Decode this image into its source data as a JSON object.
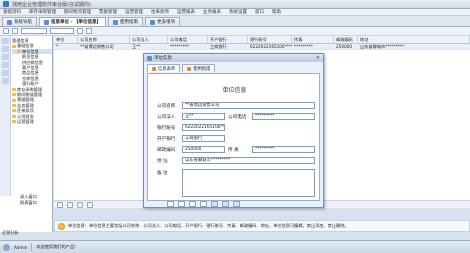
{
  "window": {
    "title": "测用企业管理软件审合版(在试期内)"
  },
  "menu": [
    "基础资料",
    "库存采购管理",
    "期间物流管理",
    "票据管理",
    "运营管理",
    "往来款项",
    "运营报表",
    "业务报表",
    "系统设置",
    "窗口",
    "帮助"
  ],
  "tabs": [
    {
      "label": "系统导航"
    },
    {
      "label": "信息单位 - 【单位信息】"
    },
    {
      "label": "使用指南"
    },
    {
      "label": "更多增项"
    }
  ],
  "toolbar": {
    "select_placeholder": "",
    "search_placeholder": ""
  },
  "tree": {
    "header": "管理信息",
    "nodes": [
      {
        "label": "基础信息",
        "level": 1
      },
      {
        "label": "单位信息",
        "level": 2,
        "selected": true
      },
      {
        "label": "职员信息",
        "level": 3
      },
      {
        "label": "供应商信息",
        "level": 3
      },
      {
        "label": "客户信息",
        "level": 3
      },
      {
        "label": "商品信息",
        "level": 3
      },
      {
        "label": "仓库信息",
        "level": 3
      },
      {
        "label": "银行账户",
        "level": 3
      },
      {
        "label": "库存采购管理",
        "level": 1
      },
      {
        "label": "期间物流管理",
        "level": 1
      },
      {
        "label": "票据管理",
        "level": 1
      },
      {
        "label": "业务管理",
        "level": 1
      },
      {
        "label": "往来款项",
        "level": 1
      },
      {
        "label": "公司财务",
        "level": 1
      },
      {
        "label": "运营管理",
        "level": 1
      }
    ],
    "bottom_items": [
      "录入窗口",
      "报表窗口"
    ],
    "footer_label": "运营分析"
  },
  "grid": {
    "columns": [
      "单位",
      "公司名称",
      "公司法人",
      "公司电话",
      "开户银行",
      "银行账号",
      "传真",
      "邮政编码",
      "地址"
    ],
    "row": [
      "*",
      "**省博运销售公司",
      "王**",
      "*********",
      "工商银行",
      "6222022165106****",
      "*********",
      "250000",
      "山东省聊城市*********"
    ]
  },
  "dialog": {
    "title": "单位信息",
    "close": "×",
    "tabs": [
      "信息表单",
      "使用指南"
    ],
    "form_title": "单位信息",
    "labels": {
      "company": "公司名称",
      "legal": "公司法人",
      "phone": "公司电话",
      "account": "银行账号",
      "bank": "开户银行",
      "postcode": "邮政编码",
      "fax": "传  真",
      "address": "地  址",
      "remark": "备  注"
    },
    "values": {
      "company": "**省博运销售公司",
      "legal": "王**",
      "phone": "*********",
      "account": "6222022165106****",
      "bank": "工商银行",
      "postcode": "250000",
      "fax": "*********",
      "address": "山东省聊城市*********",
      "remark": ""
    }
  },
  "infobar": {
    "text": "单位信息：单位信息主要包括公司名称、公司法人、公司电话、开户银行、银行账号、传真、邮政编码、地址，单位信息可编辑，禁止添加，禁止删除。"
  },
  "statusbar": {
    "user": "Admin",
    "message": "欢迎使用我们的产品!"
  },
  "colors": {
    "accent": "#5b8dd0",
    "border": "#9fb0c6",
    "info": "#f0c24a"
  }
}
